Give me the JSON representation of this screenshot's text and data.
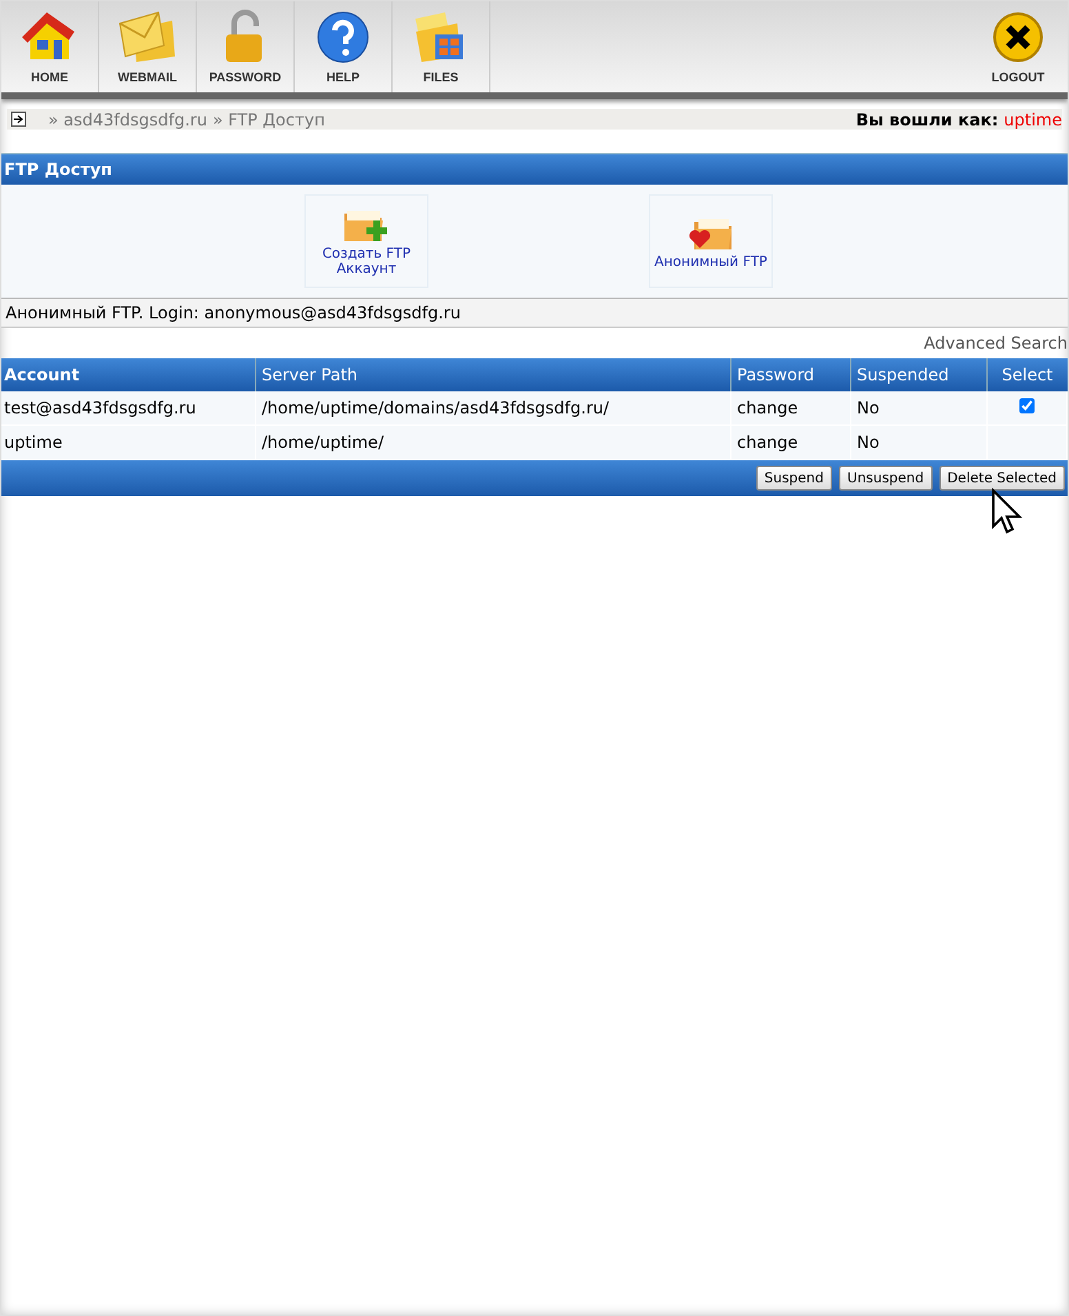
{
  "toolbar": {
    "items": [
      {
        "label": "HOME",
        "kind": "home"
      },
      {
        "label": "WEBMAIL",
        "kind": "mail"
      },
      {
        "label": "PASSWORD",
        "kind": "lock"
      },
      {
        "label": "HELP",
        "kind": "help"
      },
      {
        "label": "FILES",
        "kind": "files"
      }
    ],
    "logout": {
      "label": "LOGOUT"
    }
  },
  "breadcrumb": {
    "items": [
      "» asd43fdsgsdfg.ru",
      "» FTP Доступ"
    ],
    "login_label": "Вы вошли как:",
    "user": "uptime"
  },
  "section": {
    "title": "FTP Доступ",
    "actions": [
      {
        "label": "Создать FTP Аккаунт",
        "kind": "add"
      },
      {
        "label": "Анонимный FTP",
        "kind": "heart"
      }
    ]
  },
  "info": "Анонимный FTP. Login: anonymous@asd43fdsgsdfg.ru",
  "advanced_search": "Advanced Search",
  "table": {
    "columns": [
      "Account",
      "Server Path",
      "Password",
      "Suspended",
      "Select"
    ],
    "rows": [
      {
        "account": "test@asd43fdsgsdfg.ru",
        "path": "/home/uptime/domains/asd43fdsgsdfg.ru/",
        "password": "change",
        "suspended": "No",
        "checked": true
      },
      {
        "account": "uptime",
        "path": "/home/uptime/",
        "password": "change",
        "suspended": "No"
      }
    ]
  },
  "buttons": [
    "Suspend",
    "Unsuspend",
    "Delete Selected"
  ]
}
